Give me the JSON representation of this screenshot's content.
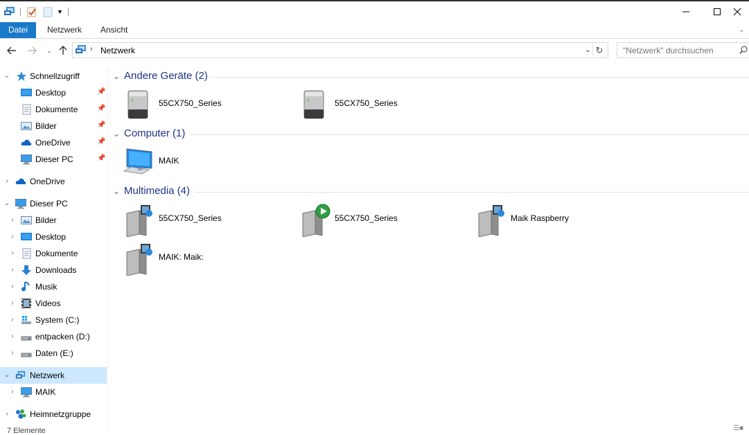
{
  "ribbon": {
    "tabs": [
      {
        "label": "Datei"
      },
      {
        "label": "Netzwerk"
      },
      {
        "label": "Ansicht"
      }
    ]
  },
  "address": {
    "location": "Netzwerk"
  },
  "search": {
    "placeholder": "\"Netzwerk\" durchsuchen"
  },
  "nav": {
    "quick_access": "Schnellzugriff",
    "quick_items": [
      "Desktop",
      "Dokumente",
      "Bilder",
      "OneDrive",
      "Dieser PC"
    ],
    "onedrive": "OneDrive",
    "this_pc": "Dieser PC",
    "pc_items": [
      "Bilder",
      "Desktop",
      "Dokumente",
      "Downloads",
      "Musik",
      "Videos",
      "System (C:)",
      "entpacken (D:)",
      "Daten (E:)"
    ],
    "network": "Netzwerk",
    "network_items": [
      "MAIK"
    ],
    "homegroup": "Heimnetzgruppe"
  },
  "groups": [
    {
      "title": "Andere Geräte (2)",
      "items": [
        "55CX750_Series",
        "55CX750_Series"
      ]
    },
    {
      "title": "Computer (1)",
      "items": [
        "MAIK"
      ]
    },
    {
      "title": "Multimedia (4)",
      "items": [
        "55CX750_Series",
        "55CX750_Series",
        "Maik Raspberry",
        "MAIK: Maik:"
      ]
    }
  ],
  "status": {
    "count": "7 Elemente"
  },
  "colors": {
    "accent": "#1979ca",
    "group_title": "#1e3287",
    "selection": "#cce8ff"
  }
}
